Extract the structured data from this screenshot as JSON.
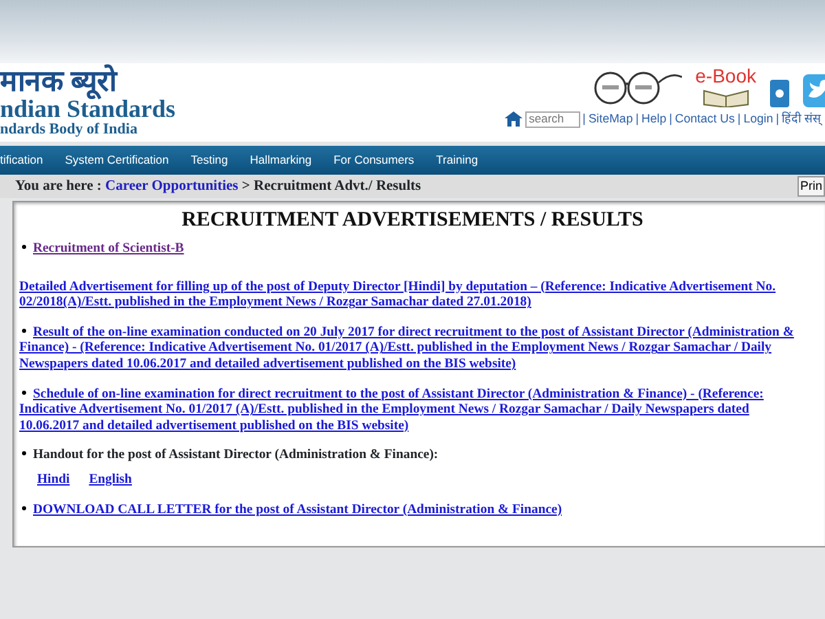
{
  "header": {
    "title_hindi": "मानक ब्यूरो",
    "title_english": "ndian Standards",
    "subtitle": "ndards Body of India",
    "ebook_label": "e-Book",
    "search": {
      "placeholder": "search"
    },
    "links": [
      {
        "separator": "|",
        "text": "SiteMap"
      },
      {
        "separator": "|",
        "text": "Help"
      },
      {
        "separator": "|",
        "text": "Contact Us"
      },
      {
        "separator": "|",
        "text": "Login"
      },
      {
        "separator": "|",
        "text": "हिंदी संस्"
      }
    ]
  },
  "nav": [
    "tification",
    "System Certification",
    "Testing",
    "Hallmarking",
    "For Consumers",
    "Training"
  ],
  "breadcrumb": {
    "prefix": "You are here :",
    "link": "Career Opportunities",
    "current": "> Recruitment Advt./ Results",
    "print_button": "Prin"
  },
  "content": {
    "title": "RECRUITMENT ADVERTISEMENTS / RESULTS",
    "items": [
      {
        "kind": "bullet-link",
        "text": "Recruitment of Scientist-B",
        "visited": true
      },
      {
        "kind": "link",
        "text": "Detailed Advertisement for filling up of the post of Deputy Director [Hindi] by deputation – (Reference: Indicative Advertisement No. 02/2018(A)/Estt. published in the Employment News / Rozgar Samachar dated 27.01.2018)",
        "visited": false
      },
      {
        "kind": "bullet-link",
        "text": "Result of the on-line examination conducted on 20 July 2017 for direct recruitment to the post of Assistant Director (Administration & Finance) - (Reference: Indicative Advertisement No. 01/2017 (A)/Estt. published in the Employment News / Rozgar Samachar / Daily Newspapers dated 10.06.2017 and detailed advertisement published on the BIS website)",
        "visited": false
      },
      {
        "kind": "bullet-link",
        "text": "Schedule of on-line examination for direct recruitment to the post of Assistant Director (Administration & Finance) - (Reference: Indicative Advertisement No. 01/2017 (A)/Estt. published in the Employment News / Rozgar Samachar / Daily Newspapers dated 10.06.2017 and detailed advertisement published on the BIS website)",
        "visited": false
      },
      {
        "kind": "bullet-text",
        "text": "Handout for the post of Assistant Director (Administration & Finance):",
        "sublinks": [
          "Hindi",
          "English"
        ]
      },
      {
        "kind": "bullet-link",
        "text": "DOWNLOAD CALL LETTER for the post of Assistant Director (Administration & Finance)",
        "visited": false
      }
    ]
  }
}
